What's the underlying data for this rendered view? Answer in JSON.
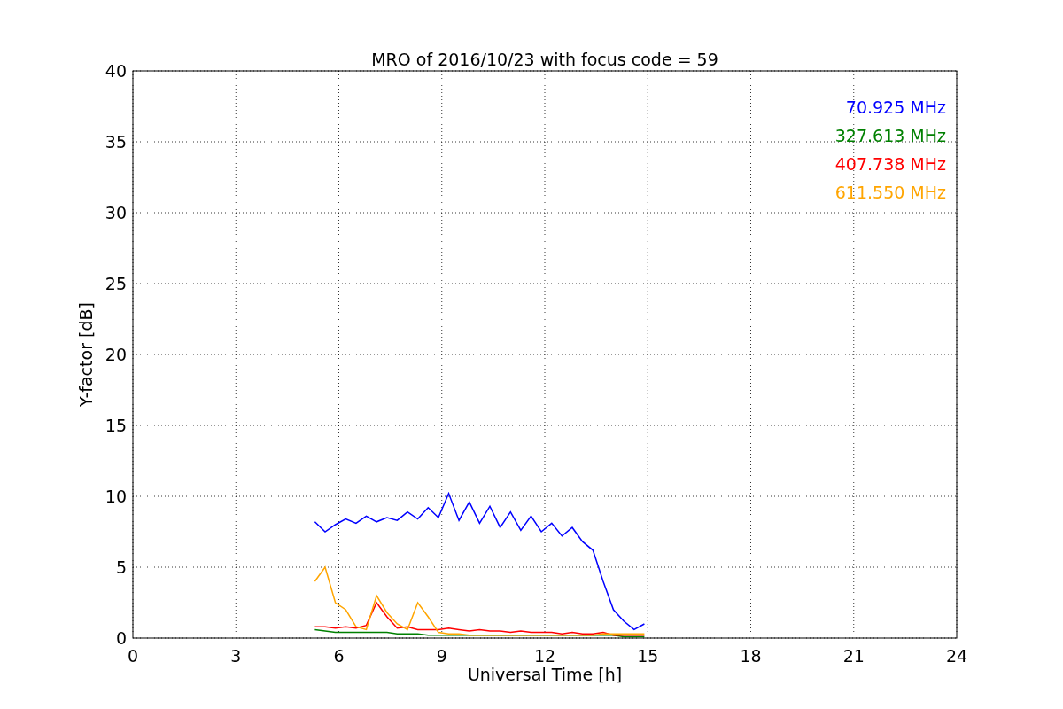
{
  "chart": {
    "chart_data": {
      "type": "line",
      "title": "MRO of 2016/10/23 with focus code = 59",
      "xlabel": "Universal Time [h]",
      "ylabel": "Y-factor [dB]",
      "x": [
        5.3,
        5.6,
        5.9,
        6.2,
        6.5,
        6.8,
        7.1,
        7.4,
        7.7,
        8.0,
        8.3,
        8.6,
        8.9,
        9.2,
        9.5,
        9.8,
        10.1,
        10.4,
        10.7,
        11.0,
        11.3,
        11.6,
        11.9,
        12.2,
        12.5,
        12.8,
        13.1,
        13.4,
        13.7,
        14.0,
        14.3,
        14.6,
        14.9
      ],
      "series": [
        {
          "name": "70.925 MHz",
          "color": "#0000ff",
          "values": [
            8.2,
            7.5,
            8.0,
            8.4,
            8.1,
            8.6,
            8.2,
            8.5,
            8.3,
            8.9,
            8.4,
            9.2,
            8.5,
            10.2,
            8.3,
            9.6,
            8.1,
            9.3,
            7.8,
            8.9,
            7.6,
            8.6,
            7.5,
            8.1,
            7.2,
            7.8,
            6.8,
            6.2,
            4.0,
            2.0,
            1.2,
            0.6,
            1.0
          ]
        },
        {
          "name": "327.613 MHz",
          "color": "#008000",
          "values": [
            0.6,
            0.5,
            0.4,
            0.4,
            0.4,
            0.4,
            0.4,
            0.4,
            0.3,
            0.3,
            0.3,
            0.2,
            0.2,
            0.2,
            0.2,
            0.2,
            0.2,
            0.2,
            0.2,
            0.2,
            0.2,
            0.2,
            0.2,
            0.2,
            0.2,
            0.2,
            0.2,
            0.2,
            0.2,
            0.2,
            0.1,
            0.1,
            0.1
          ]
        },
        {
          "name": "407.738 MHz",
          "color": "#ff0000",
          "values": [
            0.8,
            0.8,
            0.7,
            0.8,
            0.7,
            0.9,
            2.5,
            1.5,
            0.7,
            0.8,
            0.6,
            0.6,
            0.6,
            0.7,
            0.6,
            0.5,
            0.6,
            0.5,
            0.5,
            0.4,
            0.5,
            0.4,
            0.4,
            0.4,
            0.3,
            0.4,
            0.3,
            0.3,
            0.4,
            0.2,
            0.2,
            0.2,
            0.2
          ]
        },
        {
          "name": "611.550 MHz",
          "color": "#ffa500",
          "values": [
            4.0,
            5.0,
            2.5,
            2.0,
            0.8,
            0.6,
            3.0,
            1.8,
            1.0,
            0.6,
            2.5,
            1.5,
            0.4,
            0.3,
            0.3,
            0.2,
            0.2,
            0.2,
            0.2,
            0.2,
            0.2,
            0.2,
            0.2,
            0.2,
            0.2,
            0.2,
            0.2,
            0.2,
            0.3,
            0.3,
            0.3,
            0.3,
            0.3
          ]
        }
      ],
      "grid": true,
      "xlim": [
        0,
        24
      ],
      "ylim": [
        0,
        40
      ],
      "xticks": [
        0,
        3,
        6,
        9,
        12,
        15,
        18,
        21,
        24
      ],
      "yticks": [
        0,
        5,
        10,
        15,
        20,
        25,
        30,
        35,
        40
      ]
    }
  }
}
